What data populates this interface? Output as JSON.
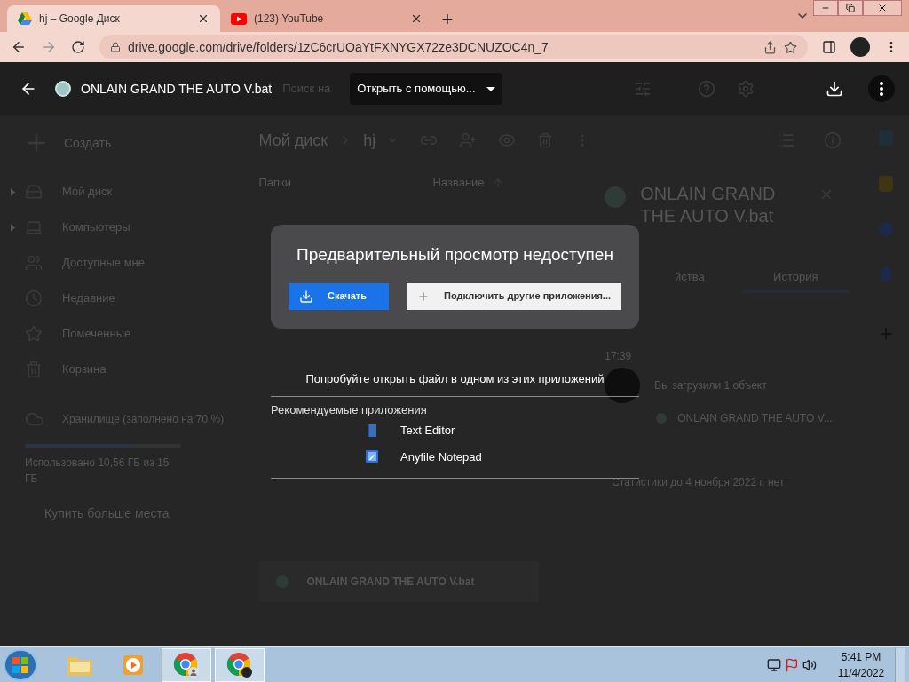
{
  "browser": {
    "tabs": [
      {
        "title": "hj – Google Диск",
        "selected": true
      },
      {
        "title": "(123) YouTube",
        "selected": false
      }
    ],
    "new_tab": "+",
    "url": "drive.google.com/drive/folders/1zC6crUOaYtFXNYGX72ze3DCNUZOC4n_7"
  },
  "viewer": {
    "file_name": "ONLAIN GRAND THE AUTO V.bat",
    "open_with": "Открыть с помощью...",
    "search_placeholder": "Поиск на"
  },
  "sidebar": {
    "create": "Создать",
    "items": [
      {
        "label": "Мой диск",
        "expandable": true
      },
      {
        "label": "Компьютеры",
        "expandable": true
      },
      {
        "label": "Доступные мне",
        "expandable": false
      },
      {
        "label": "Недавние",
        "expandable": false
      },
      {
        "label": "Помеченные",
        "expandable": false
      },
      {
        "label": "Корзина",
        "expandable": false
      }
    ],
    "storage": {
      "label": "Хранилище (заполнено на 70 %)",
      "level": 0.7,
      "usage": "Использовано 10,56 ГБ из 15 ГБ",
      "buy": "Купить больше места"
    }
  },
  "breadcrumb": [
    "Мой диск",
    "hj"
  ],
  "columns": [
    "Папки",
    "Название"
  ],
  "file_chip": "ONLAIN GRAND THE AUTO V.bat",
  "details": {
    "title": "ONLAIN GRAND THE AUTO V.bat",
    "tabs": [
      {
        "label": "йства",
        "selected": false
      },
      {
        "label": "История",
        "selected": true
      }
    ],
    "time": "17:39",
    "activity": "Вы загрузили 1 объект",
    "activity_file": "ONLAIN GRAND THE AUTO V...",
    "stats": "Статистики до 4 ноября 2022 г. нет"
  },
  "dialog": {
    "title": "Предварительный просмотр недоступен",
    "download": "Скачать",
    "connect": "Подключить другие приложения...",
    "hint": "Попробуйте открыть файл в одном из этих приложений",
    "recommended": "Рекомендуемые приложения",
    "apps": [
      {
        "name": "Text Editor",
        "kind": "editor"
      },
      {
        "name": "Anyfile Notepad",
        "kind": "notepad"
      }
    ]
  },
  "taskbar": {
    "apps": [
      {
        "kind": "folder",
        "selected": false
      },
      {
        "kind": "media",
        "selected": false
      },
      {
        "kind": "chrome-user",
        "selected": true
      },
      {
        "kind": "chrome",
        "selected": true
      }
    ],
    "time": "5:41 PM",
    "date": "11/4/2022"
  }
}
